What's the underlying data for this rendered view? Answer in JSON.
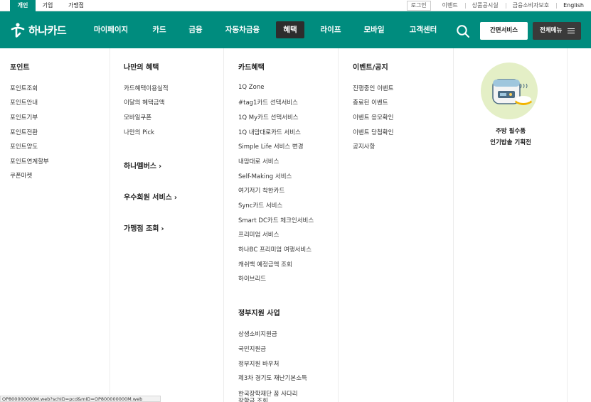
{
  "topbar": {
    "segments": [
      "개인",
      "기업",
      "가맹점"
    ],
    "utils": [
      "로그인",
      "이벤트",
      "상품공시실",
      "금융소비자보호",
      "English"
    ]
  },
  "header": {
    "logo_text": "하나카드",
    "nav": [
      "마이페이지",
      "카드",
      "금융",
      "자동차금융",
      "혜택",
      "라이프",
      "모바일",
      "고객센터"
    ],
    "active_nav": "혜택",
    "quick_service": "간편서비스",
    "all_menu": "전체메뉴",
    "brand_color": "#008c7e"
  },
  "menu": {
    "points": {
      "title": "포인트",
      "items": [
        "포인트조회",
        "포인트안내",
        "포인트기부",
        "포인트전환",
        "포인트양도",
        "포인트연계할부",
        "쿠폰마켓"
      ]
    },
    "my_benefits": {
      "title": "나만의 혜택",
      "items": [
        "카드혜택이용실적",
        "이달의 혜택금액",
        "모바일쿠폰",
        "나만의 Pick"
      ],
      "subheads": [
        "하나멤버스",
        "우수회원 서비스",
        "가맹점 조회"
      ]
    },
    "card_benefits": {
      "title": "카드혜택",
      "items": [
        "1Q Zone",
        "#tag1카드 선택서비스",
        "1Q My카드 선택서비스",
        "1Q 내맘대로카드 서비스",
        "Simple Life 서비스 변경",
        "내맘대로 서비스",
        "Self-Making 서비스",
        "여기저기 착한카드",
        "Sync카드 서비스",
        "Smart DC카드 체크인서비스",
        "프리미엄 서비스",
        "하나BC 프리미엄 여행서비스",
        "캐쉬백 예정금액 조회",
        "하이브리드"
      ],
      "gov_title": "정부지원 사업",
      "gov_items": [
        "상생소비지원금",
        "국민지원금",
        "정부지원 바우처",
        "제3차 경기도 재난기본소득",
        "한국장학재단 꿈 사다리",
        "장학금 조회"
      ]
    },
    "events": {
      "title": "이벤트/공지",
      "items": [
        "진행중인 이벤트",
        "종료된 이벤트",
        "이벤트 응모확인",
        "이벤트 당첨확인",
        "공지사항"
      ]
    },
    "promo": {
      "line1": "주방 필수품",
      "line2": "인기밥솥 기획전"
    }
  },
  "status_bar": {
    "url": "OP800000000M.web?schID=pcd&mID=OP800000000M.web"
  }
}
